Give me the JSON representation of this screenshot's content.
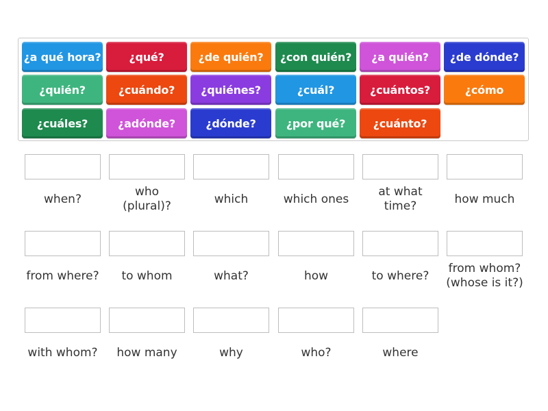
{
  "tiles": [
    {
      "text": "¿a qué hora?",
      "color": "#2196e3"
    },
    {
      "text": "¿qué?",
      "color": "#d81c3c"
    },
    {
      "text": "¿de quién?",
      "color": "#fa7a0e"
    },
    {
      "text": "¿con quién?",
      "color": "#1e8a4e"
    },
    {
      "text": "¿a quién?",
      "color": "#cf54d9"
    },
    {
      "text": "¿de dónde?",
      "color": "#2a3ccf"
    },
    {
      "text": "¿quién?",
      "color": "#3eb57f"
    },
    {
      "text": "¿cuándo?",
      "color": "#ec4810"
    },
    {
      "text": "¿quiénes?",
      "color": "#8a3ce0"
    },
    {
      "text": "¿cuál?",
      "color": "#2196e3"
    },
    {
      "text": "¿cuántos?",
      "color": "#d81c3c"
    },
    {
      "text": "¿cómo",
      "color": "#fa7a0e"
    },
    {
      "text": "¿cuáles?",
      "color": "#1e8a4e"
    },
    {
      "text": "¿adónde?",
      "color": "#cf54d9"
    },
    {
      "text": "¿dónde?",
      "color": "#2a3ccf"
    },
    {
      "text": "¿por qué?",
      "color": "#3eb57f"
    },
    {
      "text": "¿cuánto?",
      "color": "#ec4810"
    }
  ],
  "targets": [
    {
      "label": "when?"
    },
    {
      "label": "who\n(plural)?"
    },
    {
      "label": "which"
    },
    {
      "label": "which ones"
    },
    {
      "label": "at what\ntime?"
    },
    {
      "label": "how much"
    },
    {
      "label": "from where?"
    },
    {
      "label": "to whom"
    },
    {
      "label": "what?"
    },
    {
      "label": "how"
    },
    {
      "label": "to where?"
    },
    {
      "label": "from whom?\n(whose is it?)"
    },
    {
      "label": "with whom?"
    },
    {
      "label": "how many"
    },
    {
      "label": "why"
    },
    {
      "label": "who?"
    },
    {
      "label": "where"
    }
  ]
}
